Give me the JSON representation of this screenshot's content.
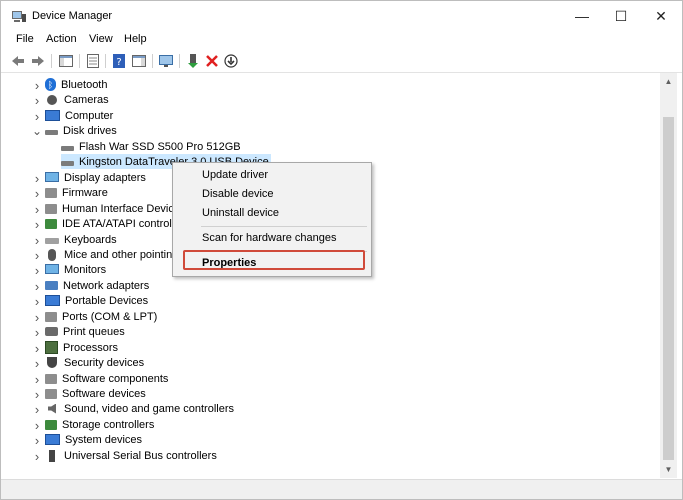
{
  "window": {
    "title": "Device Manager",
    "controls": {
      "minimize": "—",
      "maximize": "☐",
      "close": "✕"
    }
  },
  "menu": [
    "File",
    "Action",
    "View",
    "Help"
  ],
  "tree": {
    "categories": [
      {
        "label": "Bluetooth",
        "icon": "bluetooth-icon",
        "expanded": false
      },
      {
        "label": "Cameras",
        "icon": "camera-icon",
        "expanded": false
      },
      {
        "label": "Computer",
        "icon": "computer-icon",
        "expanded": false
      },
      {
        "label": "Disk drives",
        "icon": "disk-drive-icon",
        "expanded": true,
        "children": [
          {
            "label": "Flash War SSD S500 Pro 512GB",
            "icon": "disk-drive-icon"
          },
          {
            "label": "Kingston DataTraveler 3.0 USB Device",
            "icon": "disk-drive-icon",
            "selected": true
          }
        ]
      },
      {
        "label": "Display adapters",
        "icon": "display-adapter-icon",
        "expanded": false
      },
      {
        "label": "Firmware",
        "icon": "firmware-icon",
        "expanded": false
      },
      {
        "label": "Human Interface Device",
        "icon": "hid-icon",
        "expanded": false
      },
      {
        "label": "IDE ATA/ATAPI controller",
        "icon": "ide-controller-icon",
        "expanded": false
      },
      {
        "label": "Keyboards",
        "icon": "keyboard-icon",
        "expanded": false
      },
      {
        "label": "Mice and other pointing",
        "icon": "mouse-icon",
        "expanded": false
      },
      {
        "label": "Monitors",
        "icon": "monitor-icon",
        "expanded": false
      },
      {
        "label": "Network adapters",
        "icon": "network-icon",
        "expanded": false
      },
      {
        "label": "Portable Devices",
        "icon": "portable-device-icon",
        "expanded": false
      },
      {
        "label": "Ports (COM & LPT)",
        "icon": "port-icon",
        "expanded": false
      },
      {
        "label": "Print queues",
        "icon": "printer-icon",
        "expanded": false
      },
      {
        "label": "Processors",
        "icon": "processor-icon",
        "expanded": false
      },
      {
        "label": "Security devices",
        "icon": "security-icon",
        "expanded": false
      },
      {
        "label": "Software components",
        "icon": "software-component-icon",
        "expanded": false
      },
      {
        "label": "Software devices",
        "icon": "software-device-icon",
        "expanded": false
      },
      {
        "label": "Sound, video and game controllers",
        "icon": "speaker-icon",
        "expanded": false
      },
      {
        "label": "Storage controllers",
        "icon": "storage-controller-icon",
        "expanded": false
      },
      {
        "label": "System devices",
        "icon": "system-device-icon",
        "expanded": false
      },
      {
        "label": "Universal Serial Bus controllers",
        "icon": "usb-icon",
        "expanded": false
      }
    ]
  },
  "context_menu": {
    "items": [
      "Update driver",
      "Disable device",
      "Uninstall device",
      "Scan for hardware changes",
      "Properties"
    ],
    "highlighted": "Properties",
    "highlight_color": "#d04a3a"
  },
  "colors": {
    "selection": "#cce8ff",
    "delete_red": "#e02020"
  }
}
